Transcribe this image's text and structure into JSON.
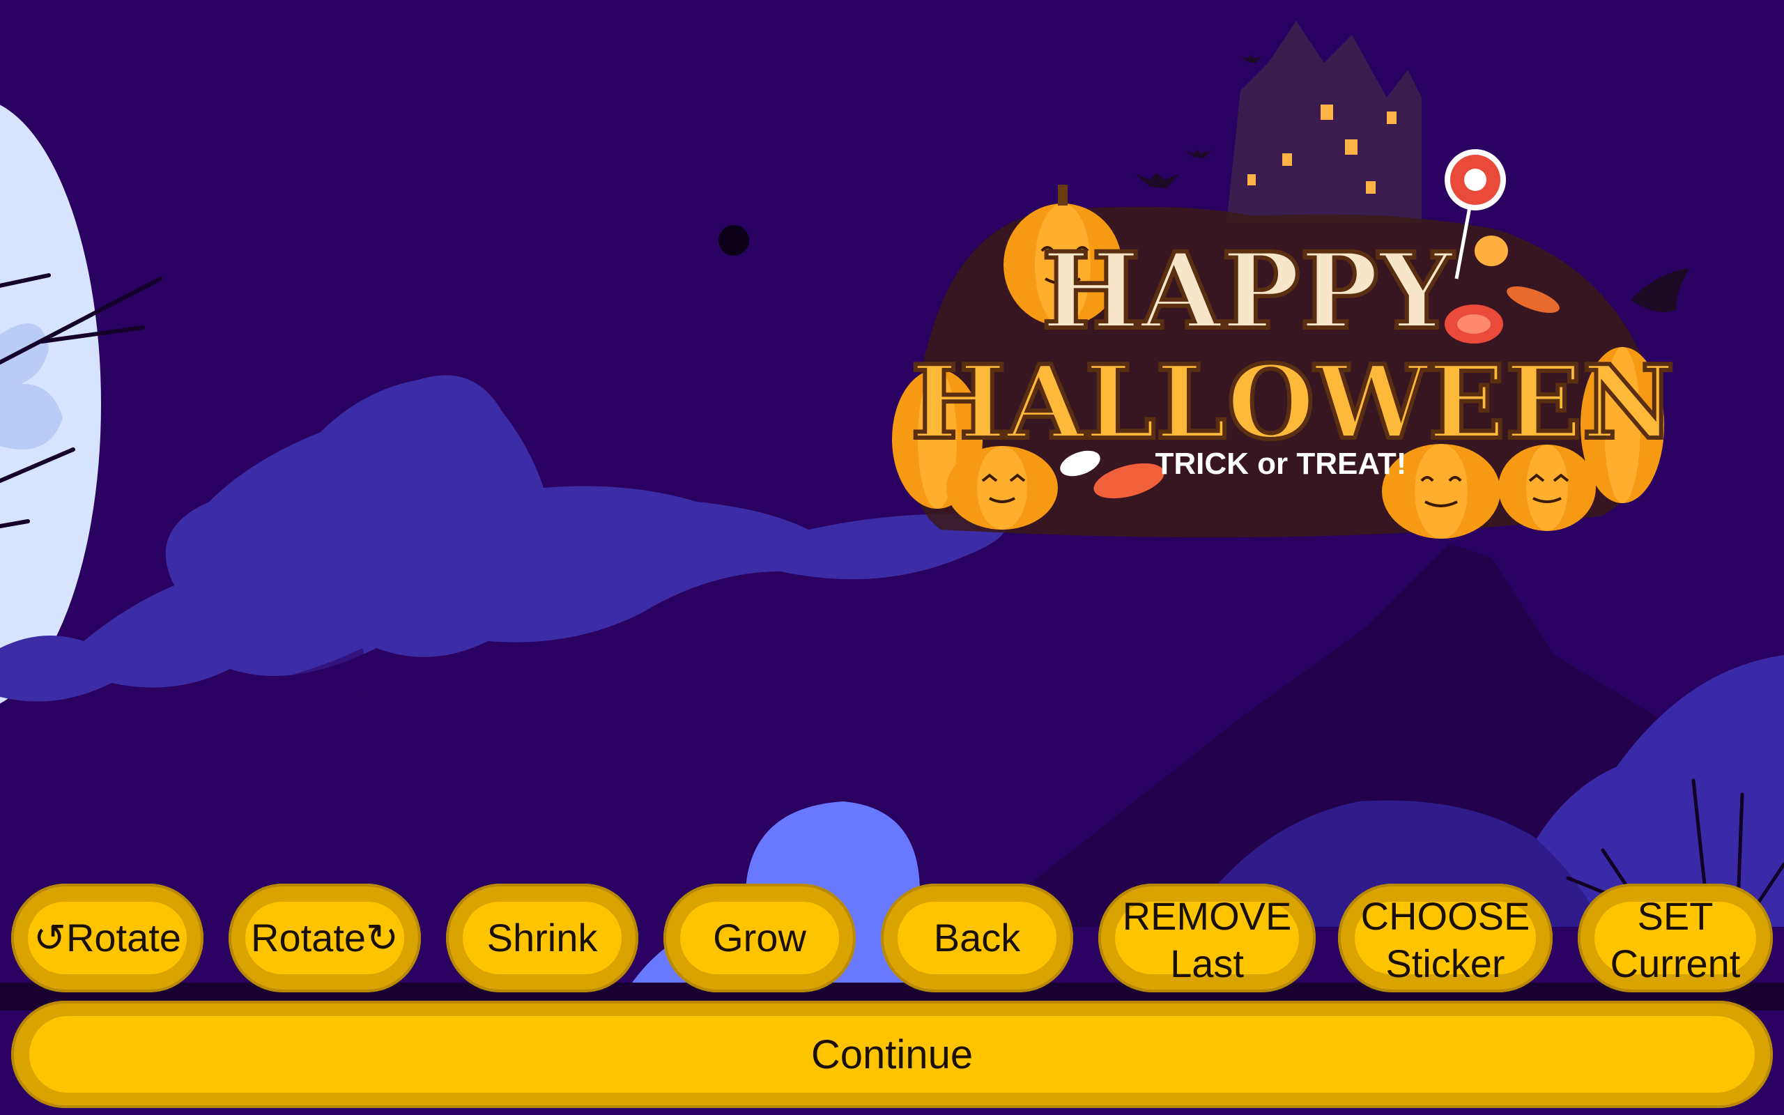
{
  "logo": {
    "line1": "HAPPY",
    "line2": "HALLOWEEN",
    "tagline": "TRICK or TREAT!"
  },
  "toolbar": {
    "rotate_left": "↺Rotate",
    "rotate_right": "Rotate↻",
    "shrink": "Shrink",
    "grow": "Grow",
    "back": "Back",
    "remove_line1": "REMOVE",
    "remove_line2": "Last",
    "choose_line1": "CHOOSE",
    "choose_line2": "Sticker",
    "set_line1": "SET",
    "set_line2": "Current"
  },
  "continue_label": "Continue",
  "colors": {
    "sky": "#2a0060",
    "fog": "#3b2aa0",
    "moon": "#d6e4ff",
    "button": "#ffc400",
    "button_rim": "#d9a300",
    "pumpkin": "#f59a12"
  }
}
